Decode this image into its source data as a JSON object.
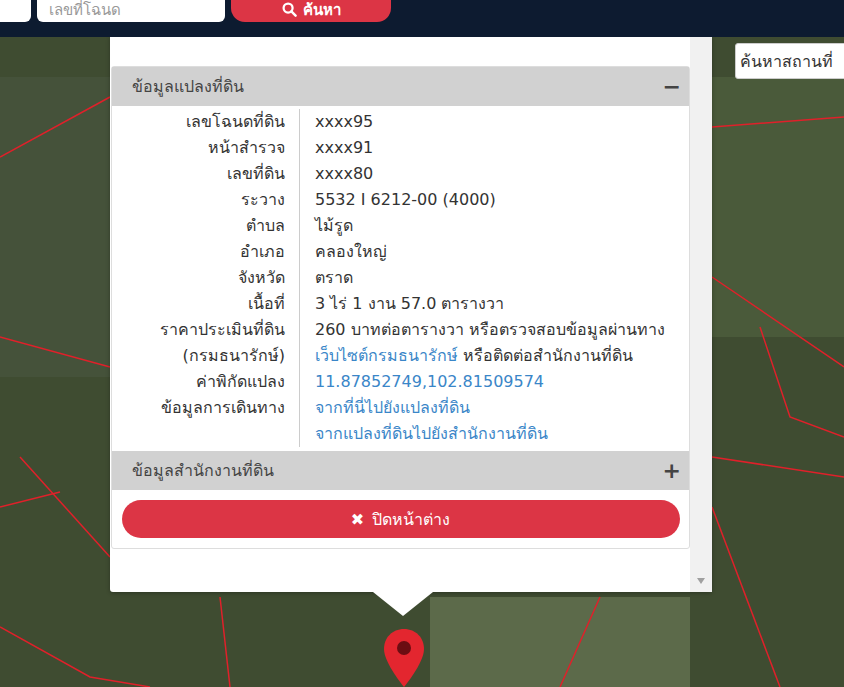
{
  "search_bar": {
    "select_partial": true,
    "input_placeholder": "เลขที่โฉนด",
    "button": "ค้นหา"
  },
  "map": {
    "place_search_placeholder": "ค้นหาสถานที่"
  },
  "popup": {
    "sections": [
      {
        "title": "ข้อมูลแปลงที่ดิน",
        "toggle": "−",
        "expanded": true,
        "rows": [
          {
            "label": [
              "เลขโฉนดที่ดิน"
            ],
            "value": [
              [
                {
                  "text": "xxxx95",
                  "link": false
                }
              ]
            ]
          },
          {
            "label": [
              "หน้าสำรวจ"
            ],
            "value": [
              [
                {
                  "text": "xxxx91",
                  "link": false
                }
              ]
            ]
          },
          {
            "label": [
              "เลขที่ดิน"
            ],
            "value": [
              [
                {
                  "text": "xxxx80",
                  "link": false
                }
              ]
            ]
          },
          {
            "label": [
              "ระวาง"
            ],
            "value": [
              [
                {
                  "text": "5532 I 6212-00 (4000)",
                  "link": false
                }
              ]
            ]
          },
          {
            "label": [
              "ตำบล"
            ],
            "value": [
              [
                {
                  "text": "ไม้รูด",
                  "link": false
                }
              ]
            ]
          },
          {
            "label": [
              "อำเภอ"
            ],
            "value": [
              [
                {
                  "text": "คลองใหญ่",
                  "link": false
                }
              ]
            ]
          },
          {
            "label": [
              "จังหวัด"
            ],
            "value": [
              [
                {
                  "text": "ตราด",
                  "link": false
                }
              ]
            ]
          },
          {
            "label": [
              "เนื้อที่"
            ],
            "value": [
              [
                {
                  "text": "3 ไร่ 1 งาน 57.0 ตารางวา",
                  "link": false
                }
              ]
            ]
          },
          {
            "label": [
              "ราคาประเมินที่ดิน",
              "(กรมธนารักษ์)"
            ],
            "value": [
              [
                {
                  "text": "260 บาทต่อตารางวา หรือตรวจสอบข้อมูลผ่านทาง",
                  "link": false
                }
              ],
              [
                {
                  "text": "เว็บไซต์กรมธนารักษ์",
                  "link": true
                },
                {
                  "text": " หรือติดต่อสำนักงานที่ดิน",
                  "link": false
                }
              ]
            ]
          },
          {
            "label": [
              "ค่าพิกัดแปลง"
            ],
            "value": [
              [
                {
                  "text": "11.87852749,102.81509574",
                  "link": true
                }
              ]
            ]
          },
          {
            "label": [
              "ข้อมูลการเดินทาง"
            ],
            "value": [
              [
                {
                  "text": "จากที่นี่ไปยังแปลงที่ดิน",
                  "link": true
                }
              ],
              [
                {
                  "text": "จากแปลงที่ดินไปยังสำนักงานที่ดิน",
                  "link": true
                }
              ]
            ]
          }
        ]
      },
      {
        "title": "ข้อมูลสำนักงานที่ดิน",
        "toggle": "+",
        "expanded": false,
        "rows": []
      }
    ],
    "close_button": {
      "icon": "✖",
      "label": "ปิดหน้าต่าง"
    }
  }
}
